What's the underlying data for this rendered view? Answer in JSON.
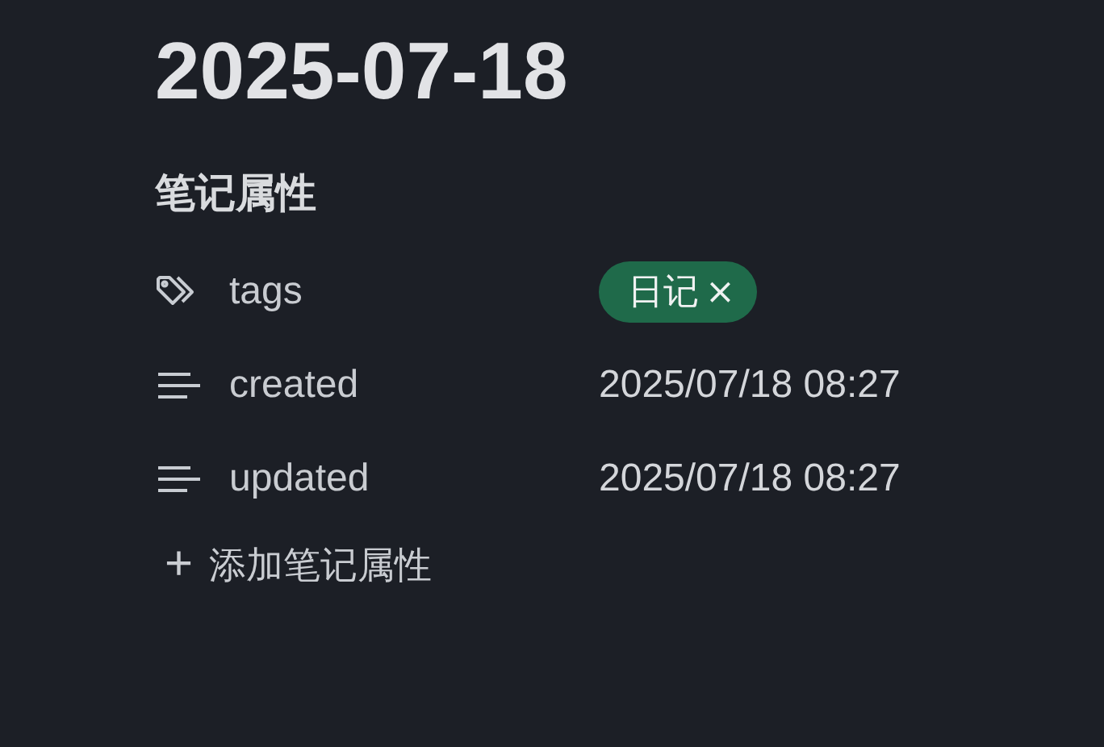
{
  "title": "2025-07-18",
  "section": {
    "heading": "笔记属性"
  },
  "properties": [
    {
      "kind": "tags",
      "name": "tags",
      "tags": [
        {
          "label": "日记",
          "remove": "×"
        }
      ]
    },
    {
      "kind": "text",
      "name": "created",
      "value": "2025/07/18 08:27"
    },
    {
      "kind": "text",
      "name": "updated",
      "value": "2025/07/18 08:27"
    }
  ],
  "add_button": {
    "icon": "+",
    "label": "添加笔记属性"
  }
}
